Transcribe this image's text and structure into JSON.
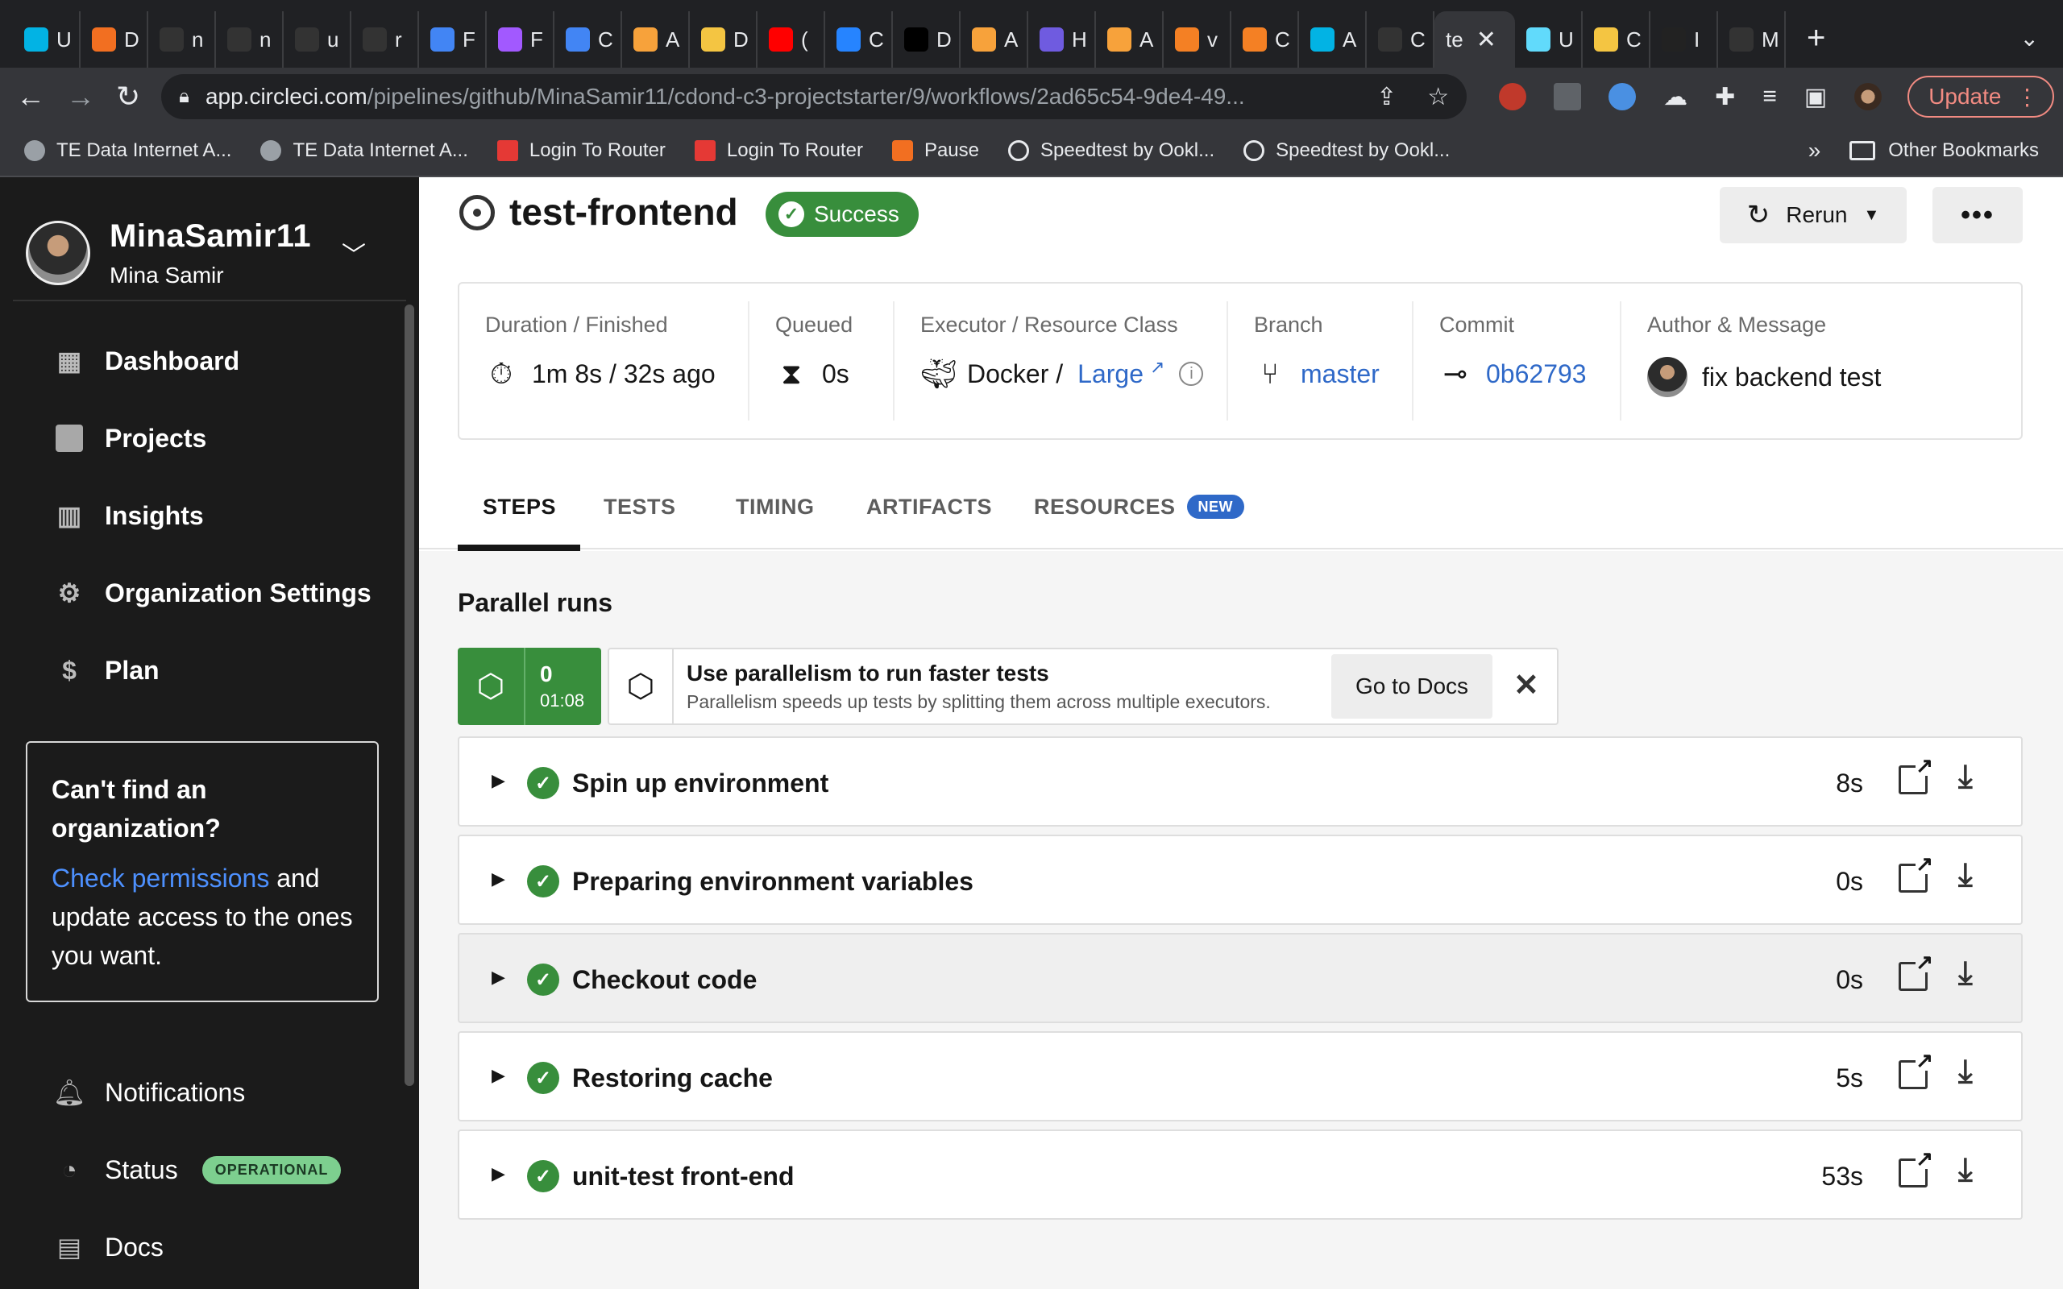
{
  "browser": {
    "tabs": [
      {
        "icon": "udacity-icon",
        "label": "U",
        "color": "#02b3e4"
      },
      {
        "icon": "soundcloud-icon",
        "label": "D",
        "color": "#f26f21"
      },
      {
        "icon": "github-icon",
        "label": "n",
        "color": "#333333"
      },
      {
        "icon": "github-icon",
        "label": "n",
        "color": "#333333"
      },
      {
        "icon": "github-icon",
        "label": "u",
        "color": "#333333"
      },
      {
        "icon": "github-icon",
        "label": "r",
        "color": "#333333"
      },
      {
        "icon": "docs-icon",
        "label": "F",
        "color": "#4285f4"
      },
      {
        "icon": "figma-icon",
        "label": "F",
        "color": "#a259ff"
      },
      {
        "icon": "translate-icon",
        "label": "C",
        "color": "#4285f4"
      },
      {
        "icon": "aws-icon",
        "label": "A",
        "color": "#f7a23b"
      },
      {
        "icon": "box-icon",
        "label": "D",
        "color": "#f4c542"
      },
      {
        "icon": "youtube-icon",
        "label": "(",
        "color": "#ff0000"
      },
      {
        "icon": "atlassian-icon",
        "label": "C",
        "color": "#2684ff"
      },
      {
        "icon": "dev-icon",
        "label": "D",
        "color": "#000000"
      },
      {
        "icon": "aws-icon",
        "label": "A",
        "color": "#f7a23b"
      },
      {
        "icon": "gear-icon",
        "label": "H",
        "color": "#6f5be0"
      },
      {
        "icon": "aws-icon",
        "label": "A",
        "color": "#f7a23b"
      },
      {
        "icon": "stackoverflow-icon",
        "label": "v",
        "color": "#f48024"
      },
      {
        "icon": "stackoverflow-icon",
        "label": "C",
        "color": "#f48024"
      },
      {
        "icon": "udacity-icon",
        "label": "A",
        "color": "#02b3e4"
      },
      {
        "icon": "github-icon",
        "label": "C",
        "color": "#333333"
      },
      {
        "icon": "react-icon",
        "label": "U",
        "color": "#61dafb"
      },
      {
        "icon": "box-icon",
        "label": "C",
        "color": "#f4c542"
      },
      {
        "icon": "book-icon",
        "label": "I",
        "color": "#222222"
      },
      {
        "icon": "github-icon",
        "label": "M",
        "color": "#333333"
      }
    ],
    "active_tab_label": "te",
    "url_host": "app.circleci.com",
    "url_path": "/pipelines/github/MinaSamir11/cdond-c3-projectstarter/9/workflows/2ad65c54-9de4-49...",
    "update_label": "Update",
    "bookmarks": [
      {
        "icon": "globe-icon",
        "label": "TE Data Internet A..."
      },
      {
        "icon": "globe-icon",
        "label": "TE Data Internet A..."
      },
      {
        "icon": "router-icon",
        "label": "Login To Router"
      },
      {
        "icon": "router-icon",
        "label": "Login To Router"
      },
      {
        "icon": "soundcloud-icon",
        "label": "Pause"
      },
      {
        "icon": "speedtest-icon",
        "label": "Speedtest by Ookl..."
      },
      {
        "icon": "speedtest-icon",
        "label": "Speedtest by Ookl..."
      }
    ],
    "bookmarks_more": "»",
    "other_bookmarks": "Other Bookmarks"
  },
  "sidebar": {
    "org_name": "MinaSamir11",
    "user_name": "Mina Samir",
    "nav": [
      {
        "icon": "dashboard-icon",
        "label": "Dashboard"
      },
      {
        "icon": "projects-icon",
        "label": "Projects"
      },
      {
        "icon": "insights-icon",
        "label": "Insights"
      },
      {
        "icon": "gear-icon",
        "label": "Organization Settings"
      },
      {
        "icon": "plan-icon",
        "label": "Plan"
      }
    ],
    "org_box": {
      "heading": "Can't find an organization?",
      "link": "Check permissions",
      "rest": " and update access to the ones you want."
    },
    "bottom_nav": {
      "notifications": "Notifications",
      "status": "Status",
      "status_badge": "OPERATIONAL",
      "docs": "Docs"
    }
  },
  "job": {
    "title": "test-frontend",
    "status": "Success",
    "status_color": "#388e3c",
    "rerun_label": "Rerun",
    "more_label": "•••"
  },
  "meta": {
    "duration": {
      "label": "Duration / Finished",
      "value": "1m 8s / 32s ago"
    },
    "queued": {
      "label": "Queued",
      "value": "0s"
    },
    "executor": {
      "label": "Executor / Resource Class",
      "value": "Docker /",
      "resource_class": "Large"
    },
    "branch": {
      "label": "Branch",
      "value": "master"
    },
    "commit": {
      "label": "Commit",
      "value": "0b62793"
    },
    "author": {
      "label": "Author & Message",
      "value": "fix backend test"
    }
  },
  "tabs": {
    "steps": "STEPS",
    "tests": "TESTS",
    "timing": "TIMING",
    "artifacts": "ARTIFACTS",
    "resources": "RESOURCES",
    "resources_badge": "NEW",
    "active": "STEPS"
  },
  "parallel": {
    "title": "Parallel runs",
    "run_index": "0",
    "run_time": "01:08",
    "tip_title": "Use parallelism to run faster tests",
    "tip_body": "Parallelism speeds up tests by splitting them across multiple executors.",
    "docs_label": "Go to Docs"
  },
  "steps": [
    {
      "name": "Spin up environment",
      "duration": "8s"
    },
    {
      "name": "Preparing environment variables",
      "duration": "0s"
    },
    {
      "name": "Checkout code",
      "duration": "0s"
    },
    {
      "name": "Restoring cache",
      "duration": "5s"
    },
    {
      "name": "unit-test front-end",
      "duration": "53s"
    }
  ]
}
